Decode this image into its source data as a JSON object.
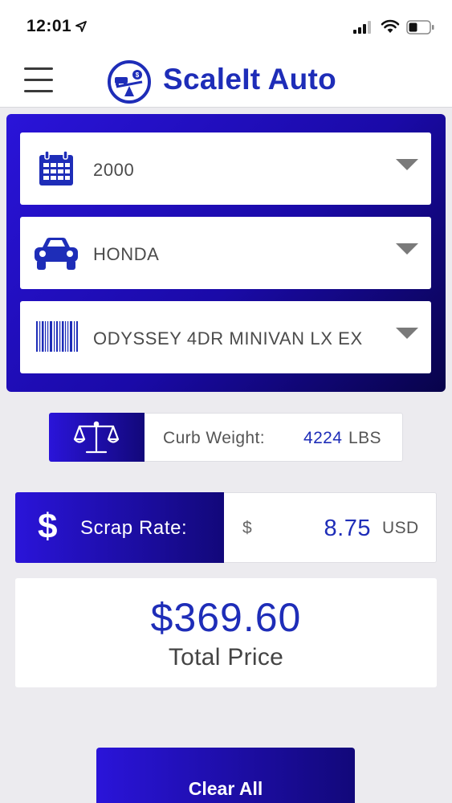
{
  "status_bar": {
    "time": "12:01"
  },
  "header": {
    "title": "ScaleIt Auto"
  },
  "selectors": {
    "year": {
      "value": "2000",
      "icon": "calendar-icon"
    },
    "make": {
      "value": "HONDA",
      "icon": "car-icon"
    },
    "model": {
      "value": "ODYSSEY 4DR MINIVAN LX EX",
      "icon": "barcode-icon"
    }
  },
  "curb_weight": {
    "label": "Curb Weight:",
    "value": "4224",
    "unit": "LBS"
  },
  "scrap_rate": {
    "label": "Scrap Rate:",
    "currency_symbol": "$",
    "value": "8.75",
    "unit": "USD"
  },
  "total": {
    "amount": "$369.60",
    "label": "Total Price"
  },
  "actions": {
    "clear_label": "Clear All"
  },
  "colors": {
    "brand_blue": "#1e2db8",
    "gradient_start": "#2a14d9",
    "gradient_end": "#12087a",
    "background": "#ecebef"
  }
}
